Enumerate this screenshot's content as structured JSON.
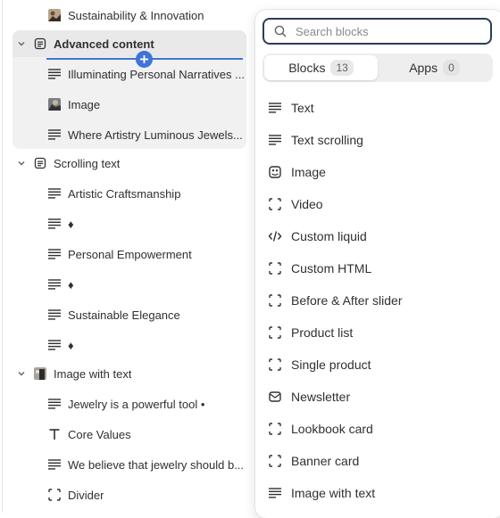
{
  "tree": {
    "items": [
      {
        "label": "Sustainability & Innovation",
        "icon": "image-thumb-icon"
      },
      {
        "label": "Advanced content",
        "icon": "section-icon"
      },
      {
        "label": "Illuminating Personal Narratives ...",
        "icon": "text-lines-icon"
      },
      {
        "label": "Image",
        "icon": "image-thumb-icon"
      },
      {
        "label": "Where Artistry Luminous Jewels...",
        "icon": "text-lines-icon"
      },
      {
        "label": "Scrolling text",
        "icon": "section-icon"
      },
      {
        "label": "Artistic Craftsmanship",
        "icon": "text-lines-icon"
      },
      {
        "label": "♦",
        "icon": "text-lines-icon"
      },
      {
        "label": "Personal Empowerment",
        "icon": "text-lines-icon"
      },
      {
        "label": "♦",
        "icon": "text-lines-icon"
      },
      {
        "label": "Sustainable Elegance",
        "icon": "text-lines-icon"
      },
      {
        "label": "♦",
        "icon": "text-lines-icon"
      },
      {
        "label": "Image with text",
        "icon": "image-thumb-icon"
      },
      {
        "label": "Jewelry is a powerful tool •",
        "icon": "text-lines-icon"
      },
      {
        "label": "Core Values",
        "icon": "heading-t-icon"
      },
      {
        "label": "We believe that jewelry should b...",
        "icon": "text-lines-icon"
      },
      {
        "label": "Divider",
        "icon": "dashed-frame-icon"
      }
    ]
  },
  "popover": {
    "search_placeholder": "Search blocks",
    "tabs": [
      {
        "label": "Blocks",
        "count": "13",
        "active": true
      },
      {
        "label": "Apps",
        "count": "0",
        "active": false
      }
    ],
    "blocks": [
      {
        "label": "Text",
        "icon": "text-lines-icon"
      },
      {
        "label": "Text scrolling",
        "icon": "text-lines-icon"
      },
      {
        "label": "Image",
        "icon": "image-icon"
      },
      {
        "label": "Video",
        "icon": "dashed-frame-icon"
      },
      {
        "label": "Custom liquid",
        "icon": "code-icon"
      },
      {
        "label": "Custom HTML",
        "icon": "dashed-frame-icon"
      },
      {
        "label": "Before & After slider",
        "icon": "dashed-frame-icon"
      },
      {
        "label": "Product list",
        "icon": "dashed-frame-icon"
      },
      {
        "label": "Single product",
        "icon": "dashed-frame-icon"
      },
      {
        "label": "Newsletter",
        "icon": "envelope-icon"
      },
      {
        "label": "Lookbook card",
        "icon": "dashed-frame-icon"
      },
      {
        "label": "Banner card",
        "icon": "dashed-frame-icon"
      },
      {
        "label": "Image with text",
        "icon": "text-lines-icon"
      }
    ]
  },
  "colors": {
    "accent": "#3f74d7",
    "search_border": "#2a3d57",
    "group_bg": "#f1f1f1",
    "text": "#303030"
  }
}
